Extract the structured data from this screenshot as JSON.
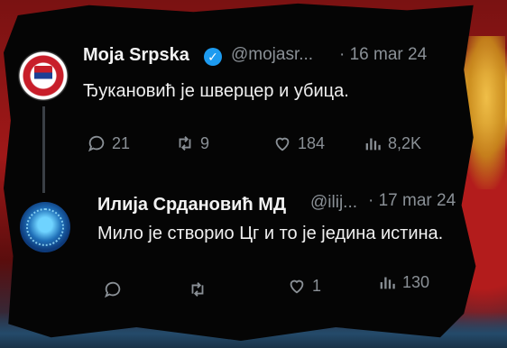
{
  "tweets": [
    {
      "author": "Moja Srpska",
      "verified": true,
      "handle": "@mojasr...",
      "date": "· 16 mar 24",
      "text": "Ђукановић је шверцер и убица.",
      "replies": "21",
      "retweets": "9",
      "likes": "184",
      "views": "8,2K"
    },
    {
      "author": "Илија Срдановић МД",
      "verified": false,
      "handle": "@ilij...",
      "date": "· 17 mar 24",
      "text": "Мило је створио Цг и то је једина истина.",
      "replies": "",
      "retweets": "",
      "likes": "1",
      "views": "130"
    }
  ],
  "icons": {
    "reply": "reply-icon",
    "retweet": "retweet-icon",
    "like": "heart-icon",
    "views": "views-icon",
    "verified": "verified-badge-icon"
  },
  "colors": {
    "card_bg": "#050505",
    "muted": "#8a9096",
    "verified_blue": "#1d9bf0"
  }
}
